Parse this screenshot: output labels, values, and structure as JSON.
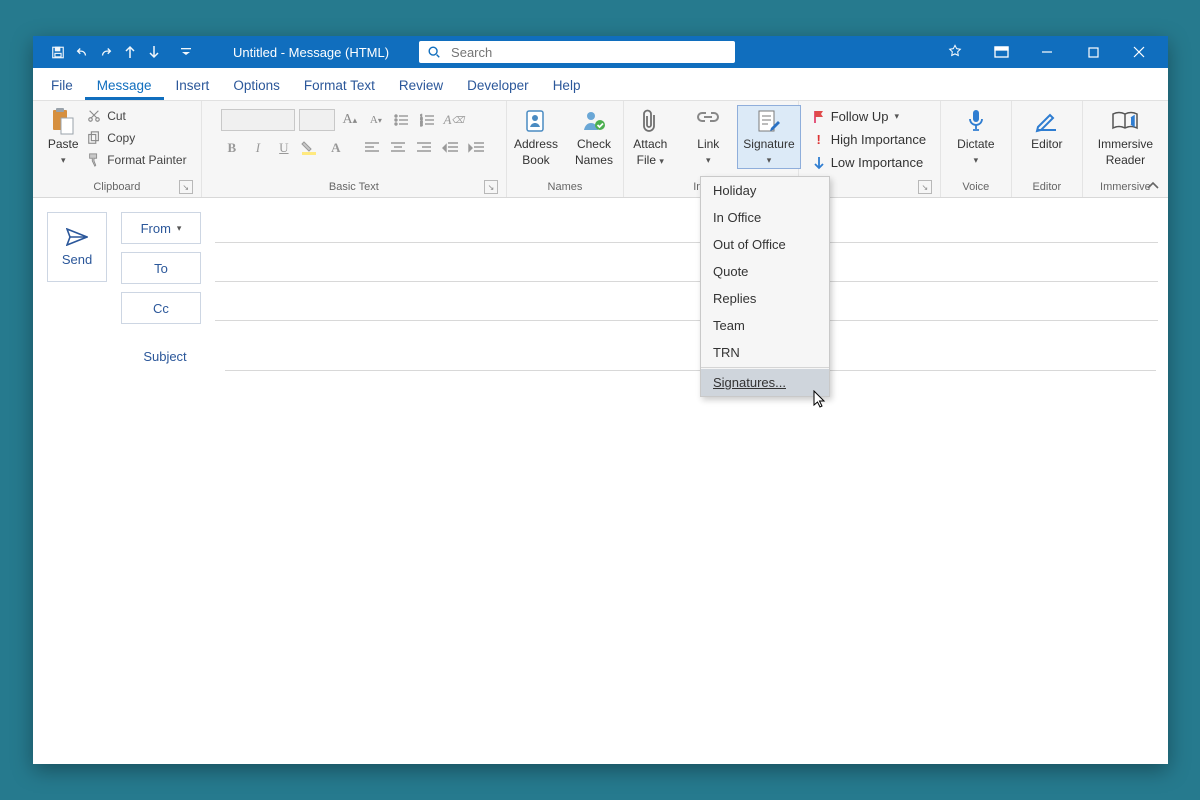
{
  "titlebar": {
    "title": "Untitled  -  Message (HTML)",
    "search_placeholder": "Search"
  },
  "menubar": {
    "file": "File",
    "message": "Message",
    "insert": "Insert",
    "options": "Options",
    "format_text": "Format Text",
    "review": "Review",
    "developer": "Developer",
    "help": "Help"
  },
  "ribbon": {
    "clipboard": {
      "label": "Clipboard",
      "paste": "Paste",
      "cut": "Cut",
      "copy": "Copy",
      "format_painter": "Format Painter"
    },
    "basic_text": {
      "label": "Basic Text"
    },
    "names": {
      "label": "Names",
      "address_book_l1": "Address",
      "address_book_l2": "Book",
      "check_names_l1": "Check",
      "check_names_l2": "Names"
    },
    "include": {
      "label": "Include",
      "attach_file_l1": "Attach",
      "attach_file_l2": "File",
      "link": "Link",
      "signature": "Signature"
    },
    "tags": {
      "follow_up": "Follow Up",
      "high": "High Importance",
      "low": "Low Importance"
    },
    "voice": {
      "label": "Voice",
      "dictate": "Dictate"
    },
    "editor": {
      "label": "Editor",
      "editor": "Editor"
    },
    "immersive": {
      "label": "Immersive",
      "reader_l1": "Immersive",
      "reader_l2": "Reader"
    }
  },
  "signature_menu": {
    "items": [
      "Holiday",
      "In Office",
      "Out of Office",
      "Quote",
      "Replies",
      "Team",
      "TRN"
    ],
    "signatures": "Signatures..."
  },
  "compose": {
    "send": "Send",
    "from": "From",
    "to": "To",
    "cc": "Cc",
    "subject_label": "Subject"
  }
}
